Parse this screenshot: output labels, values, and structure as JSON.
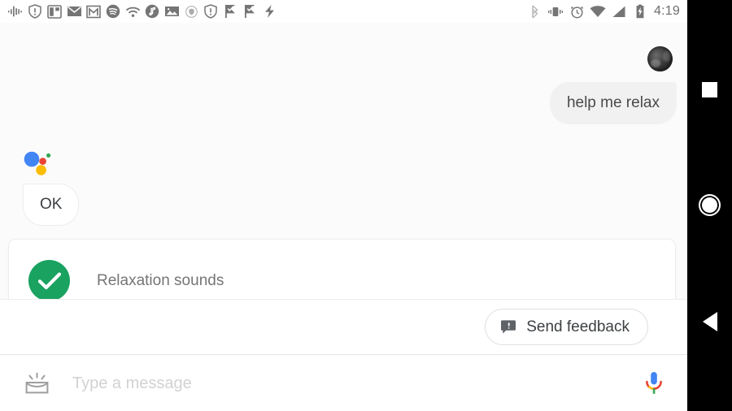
{
  "status_bar": {
    "time": "4:19",
    "left_icons": [
      "assistant-waveform-icon",
      "shield-alert-icon",
      "split-screen-icon",
      "email-icon",
      "gmail-icon",
      "spotify-icon",
      "cast-wifi-icon",
      "music-note-icon",
      "photo-icon",
      "shield-small-icon",
      "shield-alert-2-icon",
      "flag-check-icon",
      "flag-check-2-icon",
      "flash-icon"
    ],
    "right_icons": [
      "bluetooth-icon",
      "vibrate-icon",
      "alarm-icon",
      "wifi-icon",
      "signal-icon",
      "battery-charging-icon"
    ]
  },
  "conversation": {
    "avatar_name": "user-avatar",
    "user_message": "help me relax",
    "assistant_logo_name": "google-assistant-logo",
    "assistant_message": "OK"
  },
  "result_card": {
    "status_icon": "green-check-circle-icon",
    "title": "Relaxation sounds",
    "chip_label": ""
  },
  "feedback_bar": {
    "icon": "feedback-bubble-icon",
    "label": "Send feedback"
  },
  "input_bar": {
    "keyboard_icon": "keyboard-hide-icon",
    "placeholder": "Type a message",
    "value": "",
    "mic_icon": "google-mic-icon"
  },
  "nav_bar": {
    "recents_label": "recents-square",
    "home_label": "home-circle",
    "back_label": "back-triangle"
  },
  "colors": {
    "page_bg": "#fbfbfb",
    "card_bg": "#ffffff",
    "user_bubble_bg": "#f1f1f1",
    "green": "#1aa260",
    "blue": "#4285f4",
    "red": "#ea4335",
    "yellow": "#fbbc05",
    "text": "#3c4043",
    "muted_text": "#757575",
    "nav_bg": "#000000"
  }
}
